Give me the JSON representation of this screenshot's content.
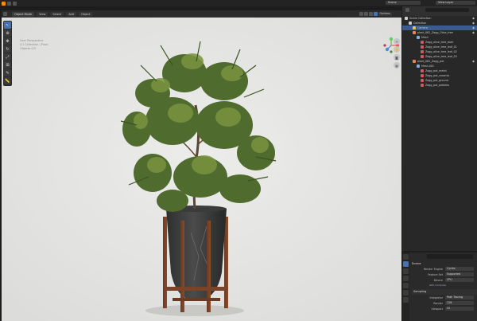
{
  "topbar": {
    "scene": "Scene",
    "view_layer": "View Layer"
  },
  "viewport_header": {
    "mode": "Object Mode",
    "menus": [
      "View",
      "Select",
      "Add",
      "Object"
    ],
    "options": "Options"
  },
  "viewport_overlay": {
    "lines": [
      "User Perspective",
      "(1) Collection | Plant",
      "Objects 0/3"
    ]
  },
  "gizmo": {
    "x": "X",
    "y": "Y",
    "z": "Z"
  },
  "outliner": {
    "title": "Scene Collection",
    "rows": [
      {
        "label": "Scene Collection",
        "indent": 0,
        "icon_color": "#cfcfcf",
        "selected": false
      },
      {
        "label": "Collection",
        "indent": 1,
        "icon_color": "#cfcfcf",
        "selected": false
      },
      {
        "label": "Camera",
        "indent": 2,
        "icon_color": "#e0c35a",
        "selected": true
      },
      {
        "label": "plant_062_Zagg_Olive_tree",
        "indent": 2,
        "icon_color": "#e6894a",
        "selected": false
      },
      {
        "label": "Mesh",
        "indent": 3,
        "icon_color": "#7fb0e0",
        "selected": false
      },
      {
        "label": "Zagg_olive_tree_bark",
        "indent": 4,
        "icon_color": "#d05a5a",
        "selected": false
      },
      {
        "label": "Zagg_olive_tree_leaf_01",
        "indent": 4,
        "icon_color": "#d05a5a",
        "selected": false
      },
      {
        "label": "Zagg_olive_tree_leaf_02",
        "indent": 4,
        "icon_color": "#d05a5a",
        "selected": false
      },
      {
        "label": "Zagg_olive_tree_leaf_03",
        "indent": 4,
        "icon_color": "#d05a5a",
        "selected": false
      },
      {
        "label": "plant_062_Zagg_pot",
        "indent": 2,
        "icon_color": "#e6894a",
        "selected": false
      },
      {
        "label": "Mesh.001",
        "indent": 3,
        "icon_color": "#7fb0e0",
        "selected": false
      },
      {
        "label": "Zagg_pot_metal",
        "indent": 4,
        "icon_color": "#d05a5a",
        "selected": false
      },
      {
        "label": "Zagg_pot_ceramic",
        "indent": 4,
        "icon_color": "#d05a5a",
        "selected": false
      },
      {
        "label": "Zagg_pot_ground",
        "indent": 4,
        "icon_color": "#d05a5a",
        "selected": false
      },
      {
        "label": "Zagg_pot_pebbles",
        "indent": 4,
        "icon_color": "#d05a5a",
        "selected": false
      }
    ]
  },
  "properties": {
    "panel_title": "Scene",
    "fields": [
      {
        "label": "Render Engine",
        "value": "Cycles"
      },
      {
        "label": "Feature Set",
        "value": "Supported"
      },
      {
        "label": "Device",
        "value": "CPU"
      }
    ],
    "note": "GPU Compute",
    "section": "Sampling",
    "sampling": [
      {
        "label": "Integrator",
        "value": "Path Tracing"
      },
      {
        "label": "Render",
        "value": "128"
      },
      {
        "label": "Viewport",
        "value": "32"
      }
    ]
  }
}
